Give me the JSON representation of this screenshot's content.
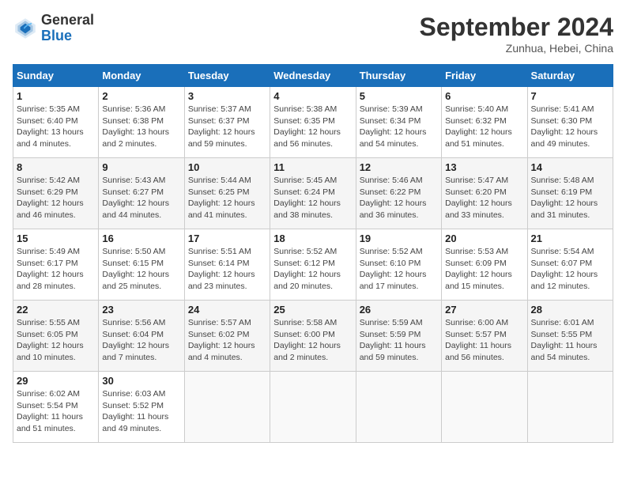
{
  "header": {
    "logo_general": "General",
    "logo_blue": "Blue",
    "title": "September 2024",
    "location": "Zunhua, Hebei, China"
  },
  "days_of_week": [
    "Sunday",
    "Monday",
    "Tuesday",
    "Wednesday",
    "Thursday",
    "Friday",
    "Saturday"
  ],
  "weeks": [
    [
      {
        "day": "1",
        "info": "Sunrise: 5:35 AM\nSunset: 6:40 PM\nDaylight: 13 hours\nand 4 minutes."
      },
      {
        "day": "2",
        "info": "Sunrise: 5:36 AM\nSunset: 6:38 PM\nDaylight: 13 hours\nand 2 minutes."
      },
      {
        "day": "3",
        "info": "Sunrise: 5:37 AM\nSunset: 6:37 PM\nDaylight: 12 hours\nand 59 minutes."
      },
      {
        "day": "4",
        "info": "Sunrise: 5:38 AM\nSunset: 6:35 PM\nDaylight: 12 hours\nand 56 minutes."
      },
      {
        "day": "5",
        "info": "Sunrise: 5:39 AM\nSunset: 6:34 PM\nDaylight: 12 hours\nand 54 minutes."
      },
      {
        "day": "6",
        "info": "Sunrise: 5:40 AM\nSunset: 6:32 PM\nDaylight: 12 hours\nand 51 minutes."
      },
      {
        "day": "7",
        "info": "Sunrise: 5:41 AM\nSunset: 6:30 PM\nDaylight: 12 hours\nand 49 minutes."
      }
    ],
    [
      {
        "day": "8",
        "info": "Sunrise: 5:42 AM\nSunset: 6:29 PM\nDaylight: 12 hours\nand 46 minutes."
      },
      {
        "day": "9",
        "info": "Sunrise: 5:43 AM\nSunset: 6:27 PM\nDaylight: 12 hours\nand 44 minutes."
      },
      {
        "day": "10",
        "info": "Sunrise: 5:44 AM\nSunset: 6:25 PM\nDaylight: 12 hours\nand 41 minutes."
      },
      {
        "day": "11",
        "info": "Sunrise: 5:45 AM\nSunset: 6:24 PM\nDaylight: 12 hours\nand 38 minutes."
      },
      {
        "day": "12",
        "info": "Sunrise: 5:46 AM\nSunset: 6:22 PM\nDaylight: 12 hours\nand 36 minutes."
      },
      {
        "day": "13",
        "info": "Sunrise: 5:47 AM\nSunset: 6:20 PM\nDaylight: 12 hours\nand 33 minutes."
      },
      {
        "day": "14",
        "info": "Sunrise: 5:48 AM\nSunset: 6:19 PM\nDaylight: 12 hours\nand 31 minutes."
      }
    ],
    [
      {
        "day": "15",
        "info": "Sunrise: 5:49 AM\nSunset: 6:17 PM\nDaylight: 12 hours\nand 28 minutes."
      },
      {
        "day": "16",
        "info": "Sunrise: 5:50 AM\nSunset: 6:15 PM\nDaylight: 12 hours\nand 25 minutes."
      },
      {
        "day": "17",
        "info": "Sunrise: 5:51 AM\nSunset: 6:14 PM\nDaylight: 12 hours\nand 23 minutes."
      },
      {
        "day": "18",
        "info": "Sunrise: 5:52 AM\nSunset: 6:12 PM\nDaylight: 12 hours\nand 20 minutes."
      },
      {
        "day": "19",
        "info": "Sunrise: 5:52 AM\nSunset: 6:10 PM\nDaylight: 12 hours\nand 17 minutes."
      },
      {
        "day": "20",
        "info": "Sunrise: 5:53 AM\nSunset: 6:09 PM\nDaylight: 12 hours\nand 15 minutes."
      },
      {
        "day": "21",
        "info": "Sunrise: 5:54 AM\nSunset: 6:07 PM\nDaylight: 12 hours\nand 12 minutes."
      }
    ],
    [
      {
        "day": "22",
        "info": "Sunrise: 5:55 AM\nSunset: 6:05 PM\nDaylight: 12 hours\nand 10 minutes."
      },
      {
        "day": "23",
        "info": "Sunrise: 5:56 AM\nSunset: 6:04 PM\nDaylight: 12 hours\nand 7 minutes."
      },
      {
        "day": "24",
        "info": "Sunrise: 5:57 AM\nSunset: 6:02 PM\nDaylight: 12 hours\nand 4 minutes."
      },
      {
        "day": "25",
        "info": "Sunrise: 5:58 AM\nSunset: 6:00 PM\nDaylight: 12 hours\nand 2 minutes."
      },
      {
        "day": "26",
        "info": "Sunrise: 5:59 AM\nSunset: 5:59 PM\nDaylight: 11 hours\nand 59 minutes."
      },
      {
        "day": "27",
        "info": "Sunrise: 6:00 AM\nSunset: 5:57 PM\nDaylight: 11 hours\nand 56 minutes."
      },
      {
        "day": "28",
        "info": "Sunrise: 6:01 AM\nSunset: 5:55 PM\nDaylight: 11 hours\nand 54 minutes."
      }
    ],
    [
      {
        "day": "29",
        "info": "Sunrise: 6:02 AM\nSunset: 5:54 PM\nDaylight: 11 hours\nand 51 minutes."
      },
      {
        "day": "30",
        "info": "Sunrise: 6:03 AM\nSunset: 5:52 PM\nDaylight: 11 hours\nand 49 minutes."
      },
      {
        "day": "",
        "info": ""
      },
      {
        "day": "",
        "info": ""
      },
      {
        "day": "",
        "info": ""
      },
      {
        "day": "",
        "info": ""
      },
      {
        "day": "",
        "info": ""
      }
    ]
  ]
}
